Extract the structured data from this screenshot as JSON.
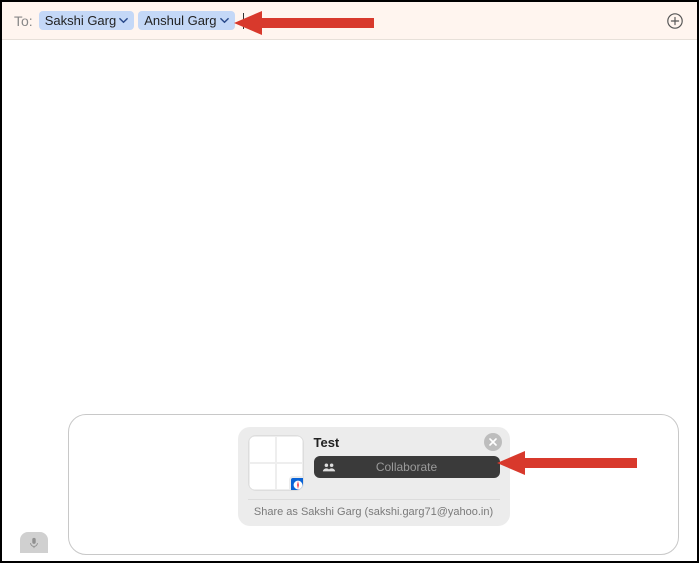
{
  "to": {
    "label": "To:",
    "recipients": [
      "Sakshi Garg",
      "Anshul Garg"
    ]
  },
  "attachment": {
    "title": "Test",
    "button_label": "Collaborate",
    "share_as": "Share as Sakshi Garg (sakshi.garg71@yahoo.in)"
  }
}
